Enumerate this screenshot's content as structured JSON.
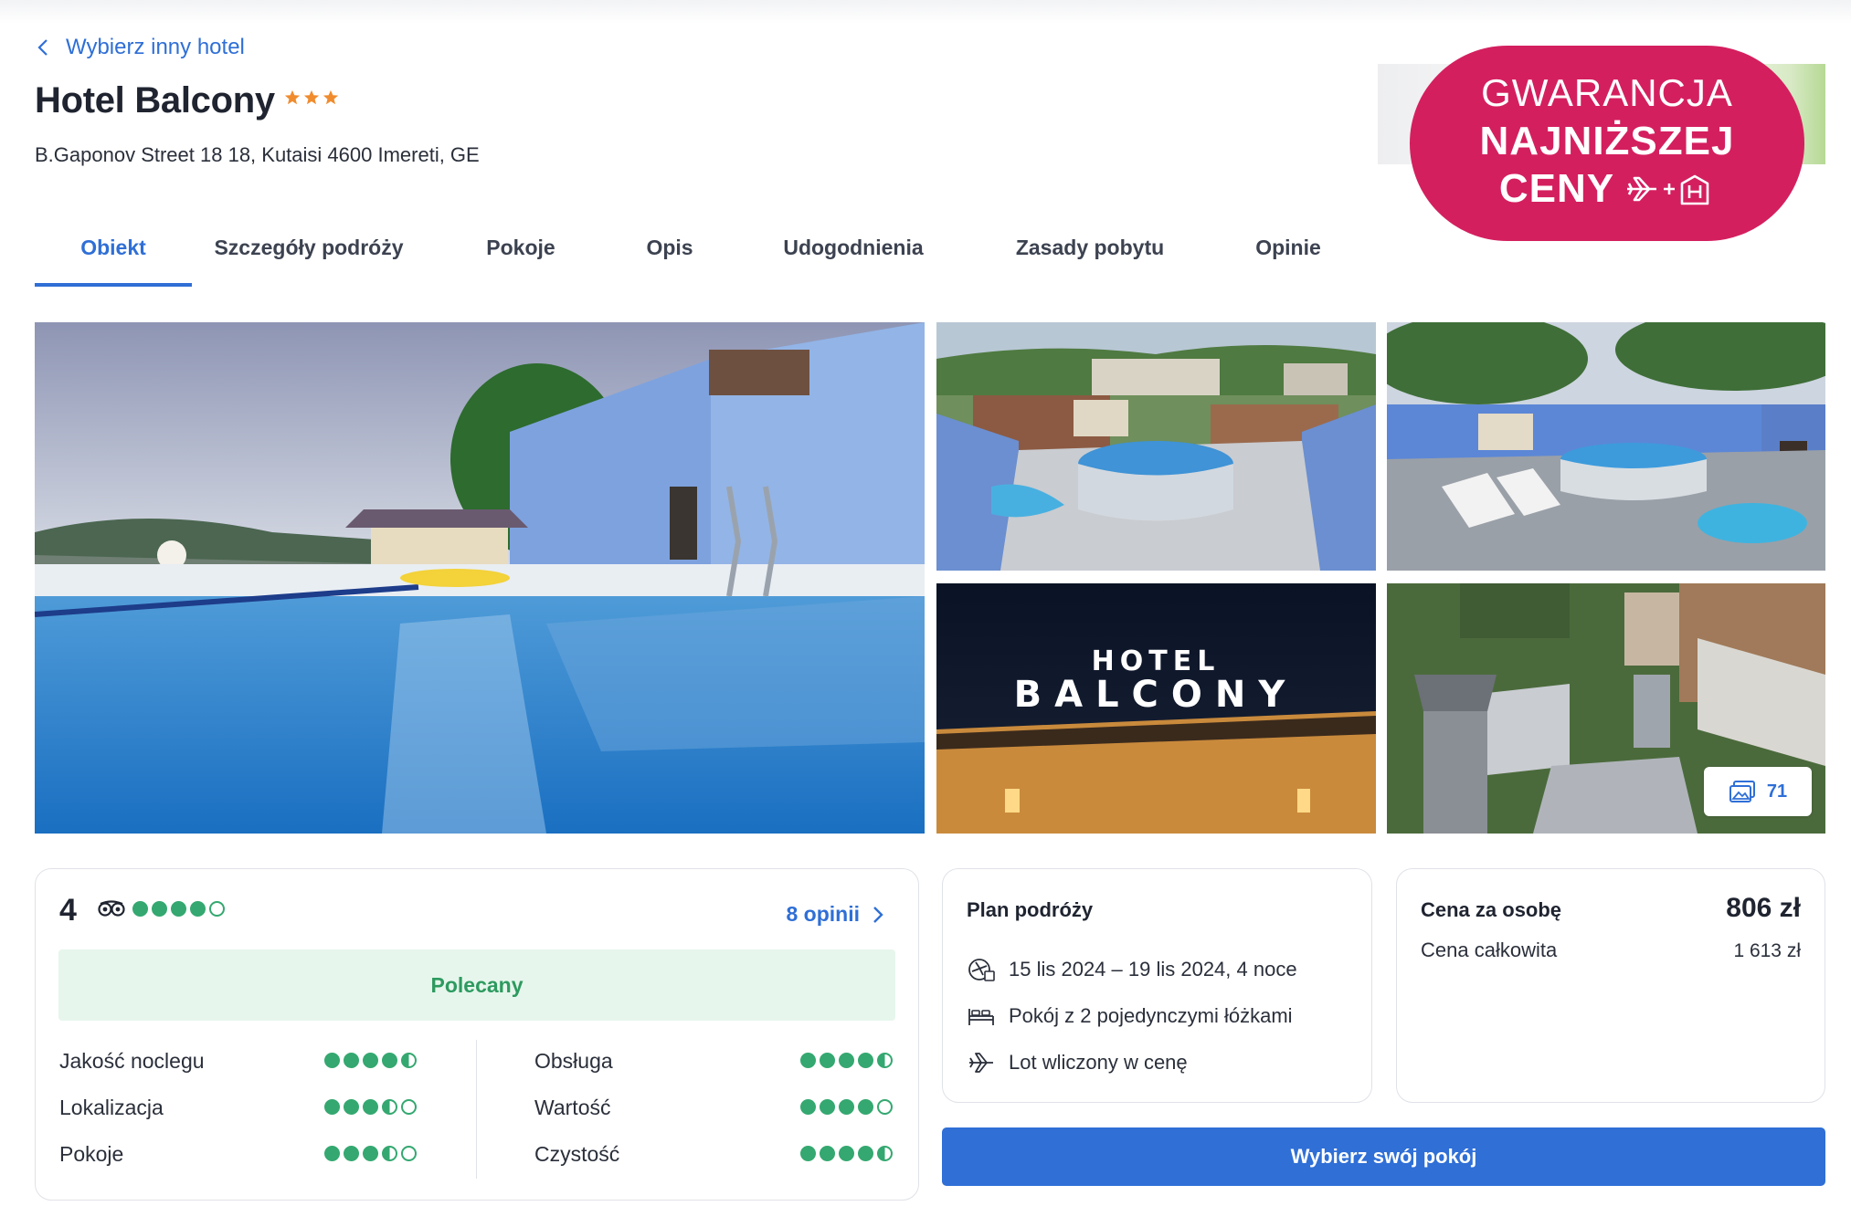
{
  "nav": {
    "back_label": "Wybierz inny hotel"
  },
  "hotel": {
    "name": "Hotel Balcony",
    "stars": 3,
    "address": "B.Gaponov Street 18 18, Kutaisi 4600 Imereti, GE"
  },
  "badge": {
    "line1": "GWARANCJA",
    "line2": "NAJNIŻSZEJ",
    "line3": "CENY",
    "color": "#d41f5f"
  },
  "tabs": [
    {
      "label": "Obiekt",
      "active": true
    },
    {
      "label": "Szczegóły podróży",
      "active": false
    },
    {
      "label": "Pokoje",
      "active": false
    },
    {
      "label": "Opis",
      "active": false
    },
    {
      "label": "Udogodnienia",
      "active": false
    },
    {
      "label": "Zasady pobytu",
      "active": false
    },
    {
      "label": "Opinie",
      "active": false
    }
  ],
  "gallery": {
    "photo_count": "71"
  },
  "rating": {
    "score": "4",
    "bubbles": 4,
    "reviews_link": "8 opinii",
    "recommended": "Polecany",
    "criteria": [
      {
        "label": "Jakość noclegu",
        "value": 4.5
      },
      {
        "label": "Lokalizacja",
        "value": 3.5
      },
      {
        "label": "Pokoje",
        "value": 3.5
      },
      {
        "label": "Obsługa",
        "value": 4.5
      },
      {
        "label": "Wartość",
        "value": 4
      },
      {
        "label": "Czystość",
        "value": 4.5
      }
    ]
  },
  "plan": {
    "title": "Plan podróży",
    "dates": "15 lis 2024 – 19 lis 2024, 4 noce",
    "room": "Pokój z 2 pojedynczymi łóżkami",
    "flight": "Lot wliczony w cenę"
  },
  "price": {
    "per_person_label": "Cena za osobę",
    "per_person": "806 zł",
    "total_label": "Cena całkowita",
    "total": "1 613 zł"
  },
  "cta": {
    "label": "Wybierz swój pokój"
  },
  "colors": {
    "accent": "#2f6fd6",
    "rating_green": "#34a870",
    "star": "#f08c2e"
  }
}
